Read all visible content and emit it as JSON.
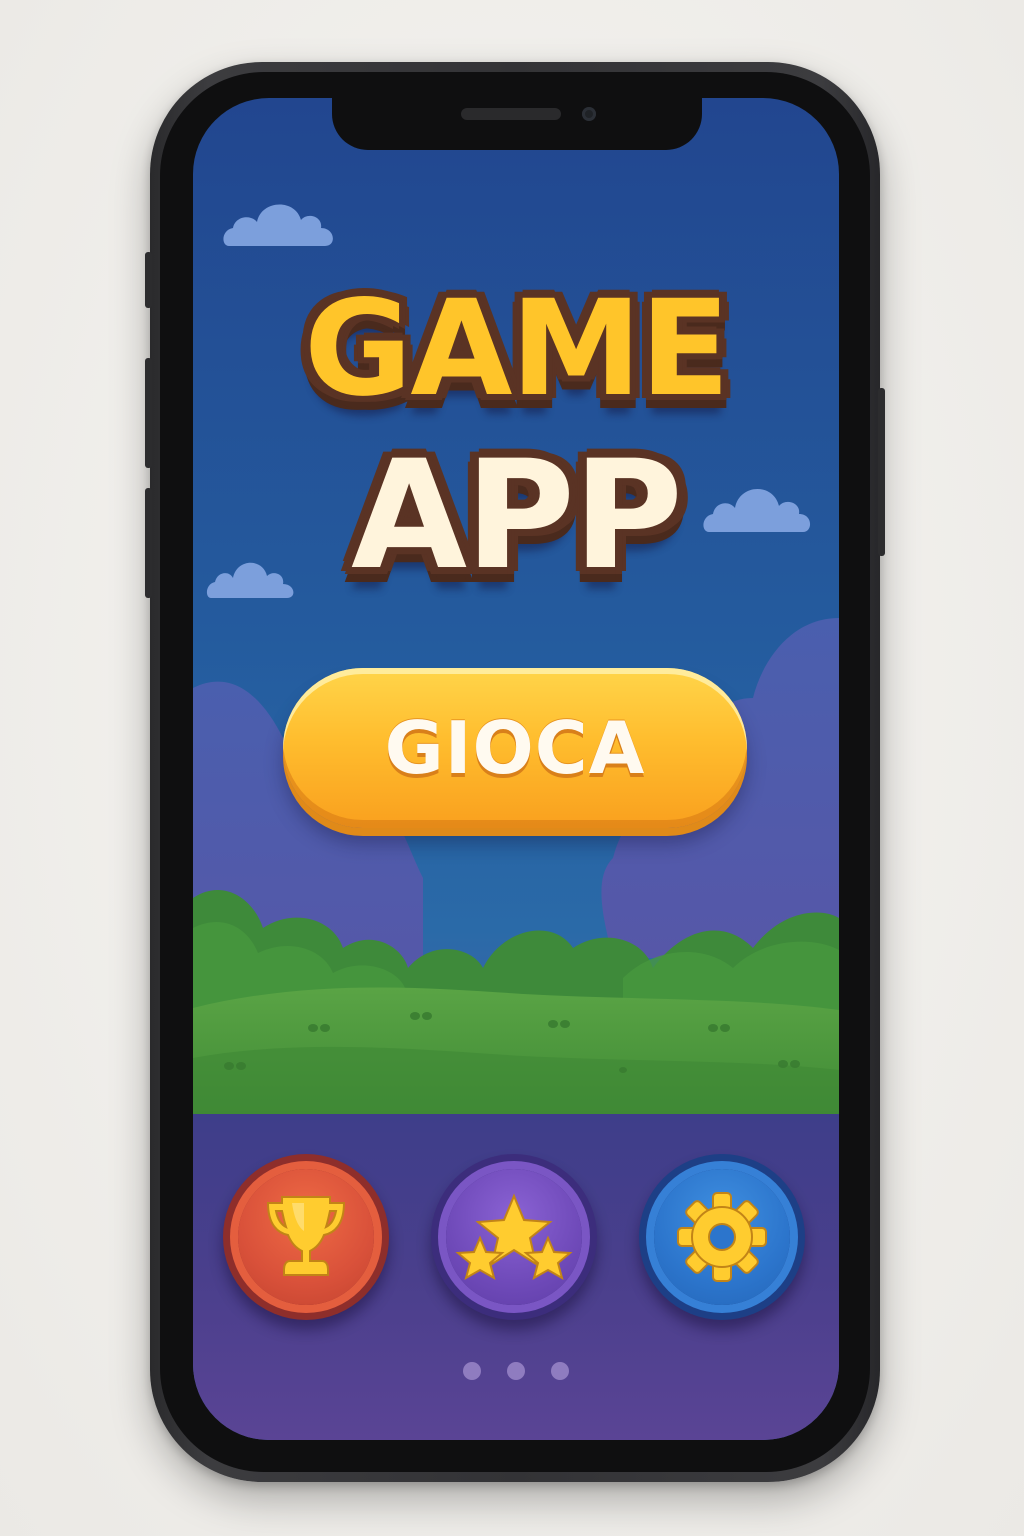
{
  "title": {
    "line1": "GAME",
    "line2": "APP"
  },
  "play_button": {
    "label": "GIOCA"
  },
  "menu": {
    "buttons": [
      {
        "icon": "trophy-icon",
        "color": "#d9513a"
      },
      {
        "icon": "stars-icon",
        "color": "#6f4ab9"
      },
      {
        "icon": "gear-icon",
        "color": "#2c75cc"
      }
    ]
  },
  "pager": {
    "pages": 3
  },
  "colors": {
    "sky": "#245b9e",
    "grass": "#4f9a3c",
    "panel": "#4a3f8c",
    "play_button": "#ffbd2e",
    "title_gold": "#ffc52a",
    "title_cream": "#fff4dc",
    "title_outline": "#5a3324"
  }
}
